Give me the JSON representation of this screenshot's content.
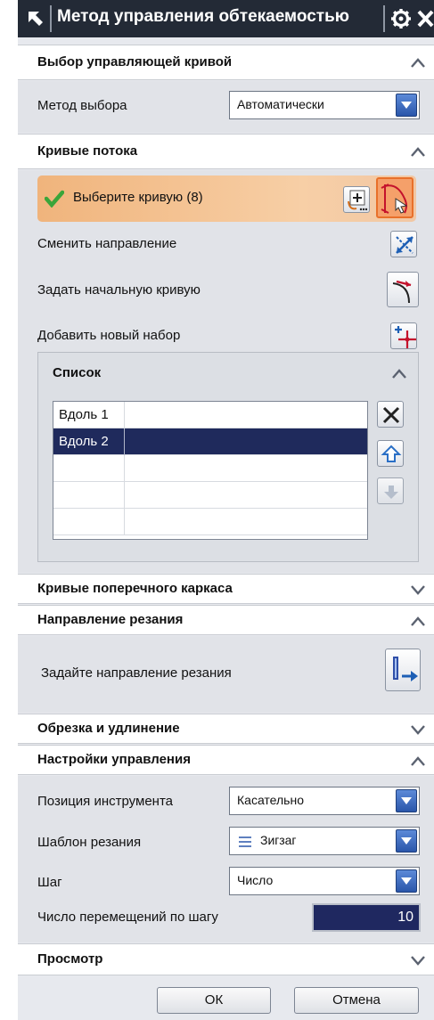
{
  "window": {
    "title": "Метод управления обтекаемостью"
  },
  "sections": {
    "curve_select": {
      "title": "Выбор управляющей кривой",
      "method_label": "Метод выбора",
      "method_value": "Автоматически"
    },
    "flow_curves": {
      "title": "Кривые потока",
      "select_curve": "Выберите кривую (8)",
      "change_direction": "Сменить направление",
      "set_start_curve": "Задать начальную кривую",
      "add_new_set": "Добавить новый набор",
      "list": {
        "title": "Список",
        "rows": [
          "Вдоль 1",
          "Вдоль 2",
          "",
          "",
          ""
        ],
        "selected_index": 1
      }
    },
    "cross_curves": {
      "title": "Кривые поперечного каркаса"
    },
    "cut_direction": {
      "title": "Направление резания",
      "specify_label": "Задайте направление резания"
    },
    "trim_extend": {
      "title": "Обрезка и удлинение"
    },
    "drive_settings": {
      "title": "Настройки управления",
      "tool_position_label": "Позиция инструмента",
      "tool_position_value": "Касательно",
      "cut_pattern_label": "Шаблон резания",
      "cut_pattern_value": "Зигзаг",
      "stepover_label": "Шаг",
      "stepover_value": "Число",
      "num_stepovers_label": "Число перемещений по шагу",
      "num_stepovers_value": "10"
    },
    "preview": {
      "title": "Просмотр"
    }
  },
  "buttons": {
    "ok": "ОК",
    "cancel": "Отмена"
  },
  "colors": {
    "titlebar": "#232a36",
    "selection_highlight": "#f0b47c",
    "list_selected": "#1f2a5c",
    "dropdown_button": "#2a56aa"
  }
}
